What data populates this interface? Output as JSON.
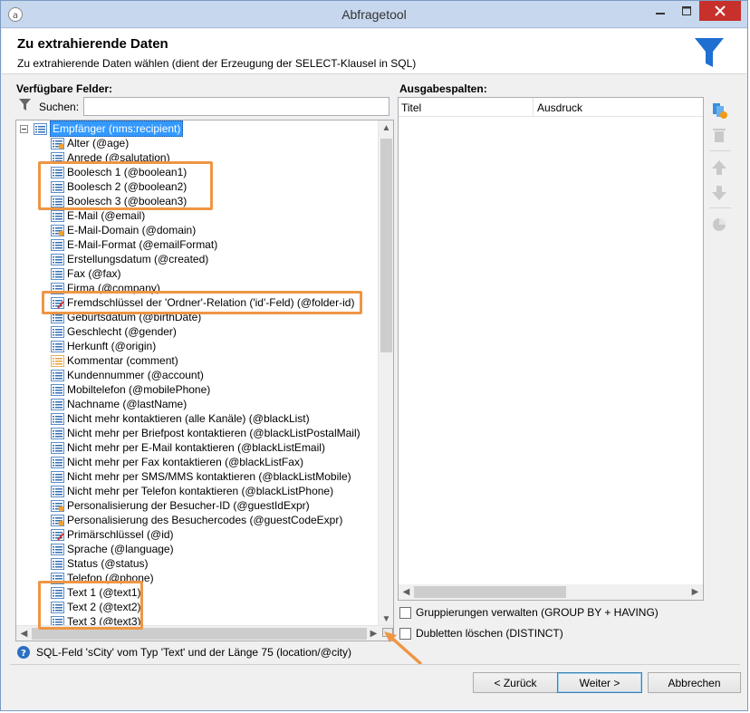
{
  "window": {
    "title": "Abfragetool"
  },
  "header": {
    "title": "Zu extrahierende Daten",
    "subtitle": "Zu extrahierende Daten wählen (dient der Erzeugung der SELECT-Klausel in SQL)"
  },
  "left_panel": {
    "label": "Verfügbare Felder:",
    "search_label": "Suchen:",
    "search_value": ""
  },
  "tree": {
    "root": "Empfänger (nms:recipient)",
    "items": [
      {
        "label": "Alter (@age)",
        "icon": "computed-field-icon"
      },
      {
        "label": "Anrede (@salutation)",
        "icon": "field-icon"
      },
      {
        "label": "Boolesch 1 (@boolean1)",
        "icon": "field-icon"
      },
      {
        "label": "Boolesch 2 (@boolean2)",
        "icon": "field-icon"
      },
      {
        "label": "Boolesch 3 (@boolean3)",
        "icon": "field-icon"
      },
      {
        "label": "E-Mail (@email)",
        "icon": "field-icon"
      },
      {
        "label": "E-Mail-Domain (@domain)",
        "icon": "computed-field-icon"
      },
      {
        "label": "E-Mail-Format (@emailFormat)",
        "icon": "field-icon"
      },
      {
        "label": "Erstellungsdatum (@created)",
        "icon": "field-icon"
      },
      {
        "label": "Fax (@fax)",
        "icon": "field-icon"
      },
      {
        "label": "Firma (@company)",
        "icon": "field-icon"
      },
      {
        "label": "Fremdschlüssel der 'Ordner'-Relation ('id'-Feld) (@folder-id)",
        "icon": "key-field-icon"
      },
      {
        "label": "Geburtsdatum (@birthDate)",
        "icon": "field-icon"
      },
      {
        "label": "Geschlecht (@gender)",
        "icon": "field-icon"
      },
      {
        "label": "Herkunft (@origin)",
        "icon": "field-icon"
      },
      {
        "label": "Kommentar (comment)",
        "icon": "element-icon"
      },
      {
        "label": "Kundennummer (@account)",
        "icon": "field-icon"
      },
      {
        "label": "Mobiltelefon (@mobilePhone)",
        "icon": "field-icon"
      },
      {
        "label": "Nachname (@lastName)",
        "icon": "field-icon"
      },
      {
        "label": "Nicht mehr kontaktieren (alle Kanäle) (@blackList)",
        "icon": "field-icon"
      },
      {
        "label": "Nicht mehr per Briefpost kontaktieren (@blackListPostalMail)",
        "icon": "field-icon"
      },
      {
        "label": "Nicht mehr per E-Mail kontaktieren (@blackListEmail)",
        "icon": "field-icon"
      },
      {
        "label": "Nicht mehr per Fax kontaktieren (@blackListFax)",
        "icon": "field-icon"
      },
      {
        "label": "Nicht mehr per SMS/MMS kontaktieren (@blackListMobile)",
        "icon": "field-icon"
      },
      {
        "label": "Nicht mehr per Telefon kontaktieren (@blackListPhone)",
        "icon": "field-icon"
      },
      {
        "label": "Personalisierung der Besucher-ID (@guestIdExpr)",
        "icon": "computed-field-icon"
      },
      {
        "label": "Personalisierung des Besuchercodes (@guestCodeExpr)",
        "icon": "computed-field-icon"
      },
      {
        "label": "Primärschlüssel (@id)",
        "icon": "key-field-icon"
      },
      {
        "label": "Sprache (@language)",
        "icon": "field-icon"
      },
      {
        "label": "Status (@status)",
        "icon": "field-icon"
      },
      {
        "label": "Telefon (@phone)",
        "icon": "field-icon"
      },
      {
        "label": "Text 1 (@text1)",
        "icon": "field-icon"
      },
      {
        "label": "Text 2 (@text2)",
        "icon": "field-icon"
      },
      {
        "label": "Text 3 (@text3)",
        "icon": "field-icon"
      }
    ]
  },
  "right_panel": {
    "label": "Ausgabespalten:",
    "columns": [
      "Titel",
      "Ausdruck"
    ],
    "group_by_label": "Gruppierungen verwalten (GROUP BY + HAVING)",
    "group_by_checked": false,
    "distinct_label": "Dubletten löschen (DISTINCT)",
    "distinct_checked": false
  },
  "status": {
    "text": "SQL-Feld 'sCity' vom Typ 'Text' und der Länge 75 (location/@city)"
  },
  "buttons": {
    "back": "< Zurück",
    "next": "Weiter >",
    "cancel": "Abbrechen"
  },
  "colors": {
    "highlight": "#ee9644",
    "selection": "#3399ff",
    "funnel": "#1f6fd1",
    "close": "#c7302b"
  }
}
